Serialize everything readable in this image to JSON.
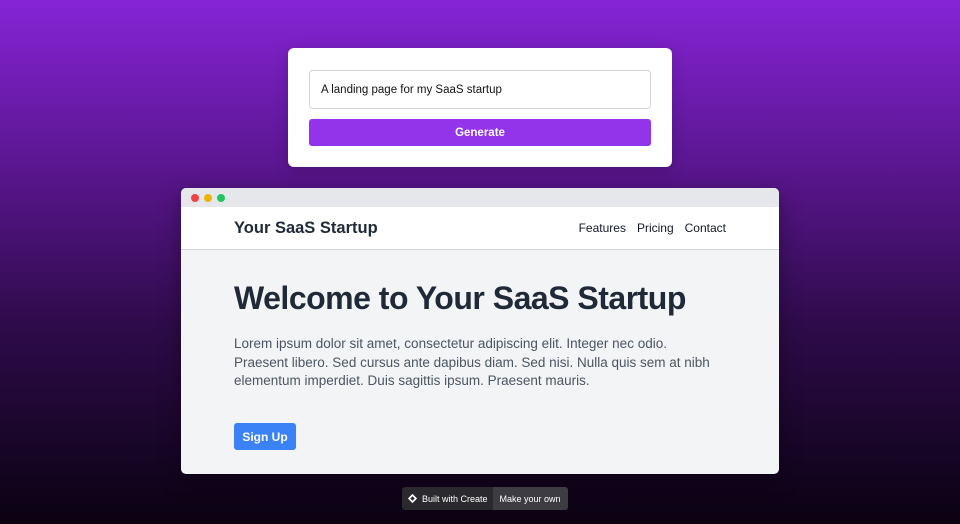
{
  "prompt": {
    "input_value": "A landing page for my SaaS startup",
    "generate_label": "Generate"
  },
  "preview": {
    "window_controls": [
      "close-dot",
      "minimize-dot",
      "maximize-dot"
    ],
    "site": {
      "brand": "Your SaaS Startup",
      "nav": {
        "features": "Features",
        "pricing": "Pricing",
        "contact": "Contact"
      },
      "hero": {
        "title": "Welcome to Your SaaS Startup",
        "text": "Lorem ipsum dolor sit amet, consectetur adipiscing elit. Integer nec odio. Praesent libero. Sed cursus ante dapibus diam. Sed nisi. Nulla quis sem at nibh elementum imperdiet. Duis sagittis ipsum. Praesent mauris.",
        "cta": "Sign Up"
      }
    }
  },
  "footer": {
    "built_with": "Built with Create",
    "make_your_own": "Make your own",
    "icon": "create-logo-icon"
  },
  "colors": {
    "accent": "#9333ea",
    "cta": "#3b82f6",
    "background_top": "#8524d6",
    "background_bottom": "#0a0211"
  }
}
